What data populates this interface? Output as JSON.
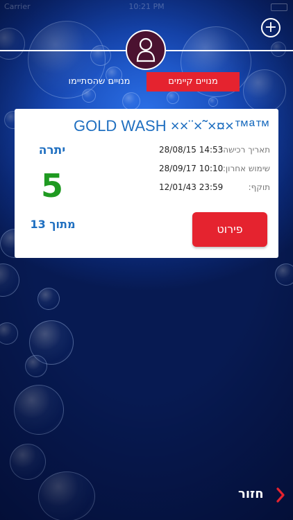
{
  "status_bar": {
    "carrier": "Carrier",
    "time": "10:21 PM"
  },
  "header": {
    "add_label": "+"
  },
  "tabs": {
    "active_label": "מנויים קיימים",
    "inactive_label": "מנויים שהסתיימו"
  },
  "card": {
    "title": "GOLD WASH ××¨×˜×¤×™ª™",
    "purchase_label": "תאריך רכישה:",
    "purchase_value": "28/08/15 14:53",
    "last_use_label": "שימוש אחרון:",
    "last_use_value": "28/09/17 10:10",
    "valid_label": "תוקף:",
    "valid_value": "12/01/43 23:59",
    "remaining_label": "יתרה",
    "remaining_value": "5",
    "of_total_label": "מתוך 13",
    "details_button": "פירוט"
  },
  "footer": {
    "back_label": "חזור"
  },
  "colors": {
    "accent_red": "#e5232f",
    "title_blue": "#1f6fc0",
    "remaining_green": "#1f9a21",
    "avatar_bg": "#4b1230"
  },
  "icons": {
    "add": "plus-circle-icon",
    "avatar": "user-icon",
    "back": "chevron-right-icon"
  }
}
